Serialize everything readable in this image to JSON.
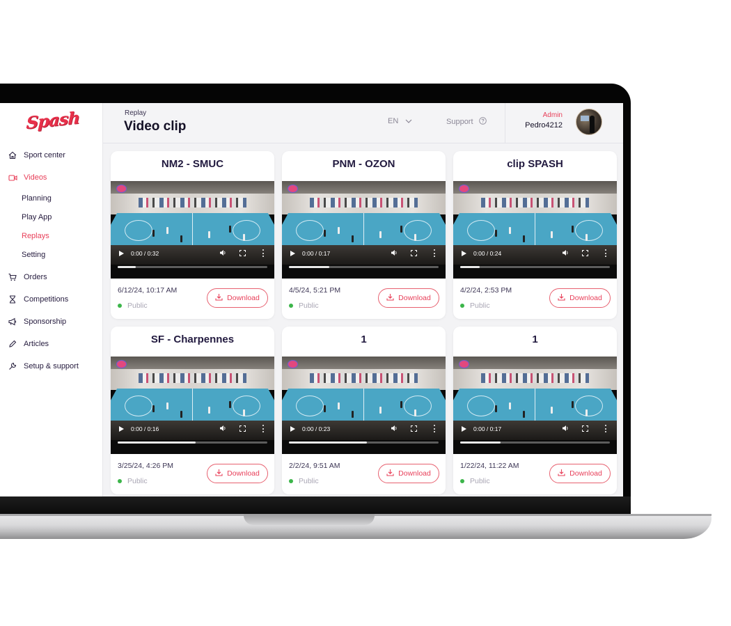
{
  "app": {
    "brand": "Spash",
    "accent_color": "#e8405a",
    "status_color": "#3cb54a"
  },
  "sidebar": {
    "items": [
      {
        "label": "Sport center",
        "icon": "home-icon"
      },
      {
        "label": "Videos",
        "icon": "video-camera-icon",
        "active": true,
        "children": [
          {
            "label": "Planning"
          },
          {
            "label": "Play App"
          },
          {
            "label": "Replays",
            "active": true
          },
          {
            "label": "Setting"
          }
        ]
      },
      {
        "label": "Orders",
        "icon": "cart-icon"
      },
      {
        "label": "Competitions",
        "icon": "trophy-icon"
      },
      {
        "label": "Sponsorship",
        "icon": "megaphone-icon"
      },
      {
        "label": "Articles",
        "icon": "pencil-icon"
      },
      {
        "label": "Setup & support",
        "icon": "wrench-icon"
      }
    ]
  },
  "header": {
    "breadcrumb": "Replay",
    "title": "Video clip",
    "language": "EN",
    "support_label": "Support",
    "user": {
      "role": "Admin",
      "name": "Pedro4212"
    }
  },
  "clips": [
    {
      "title": "NM2 - SMUC",
      "time": "0:00 / 0:32",
      "buffered": 0.12,
      "date": "6/12/24, 10:17 AM",
      "visibility": "Public",
      "download_label": "Download"
    },
    {
      "title": "PNM - OZON",
      "time": "0:00 / 0:17",
      "buffered": 0.27,
      "date": "4/5/24, 5:21 PM",
      "visibility": "Public",
      "download_label": "Download"
    },
    {
      "title": "clip SPASH",
      "time": "0:00 / 0:24",
      "buffered": 0.13,
      "date": "4/2/24, 2:53 PM",
      "visibility": "Public",
      "download_label": "Download"
    },
    {
      "title": "SF - Charpennes",
      "time": "0:00 / 0:16",
      "buffered": 0.52,
      "date": "3/25/24, 4:26 PM",
      "visibility": "Public",
      "download_label": "Download"
    },
    {
      "title": "1",
      "time": "0:00 / 0:23",
      "buffered": 0.52,
      "date": "2/2/24, 9:51 AM",
      "visibility": "Public",
      "download_label": "Download"
    },
    {
      "title": "1",
      "time": "0:00 / 0:17",
      "buffered": 0.27,
      "date": "1/22/24, 11:22 AM",
      "visibility": "Public",
      "download_label": "Download"
    }
  ]
}
